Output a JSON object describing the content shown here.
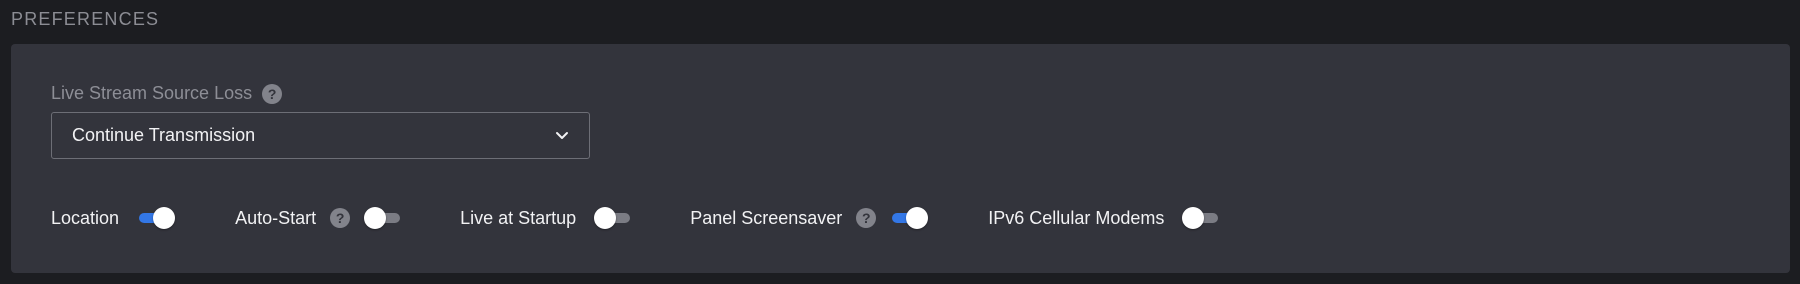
{
  "section": {
    "title": "PREFERENCES"
  },
  "source_loss": {
    "label": "Live Stream Source Loss",
    "selected": "Continue Transmission"
  },
  "toggles": [
    {
      "label": "Location",
      "has_help": false,
      "on": true
    },
    {
      "label": "Auto-Start",
      "has_help": true,
      "on": false
    },
    {
      "label": "Live at Startup",
      "has_help": false,
      "on": false
    },
    {
      "label": "Panel Screensaver",
      "has_help": true,
      "on": true
    },
    {
      "label": "IPv6 Cellular Modems",
      "has_help": false,
      "on": false
    }
  ],
  "help_glyph": "?",
  "colors": {
    "accent": "#3377e6",
    "panel": "#33343c",
    "background": "#1c1d21"
  }
}
